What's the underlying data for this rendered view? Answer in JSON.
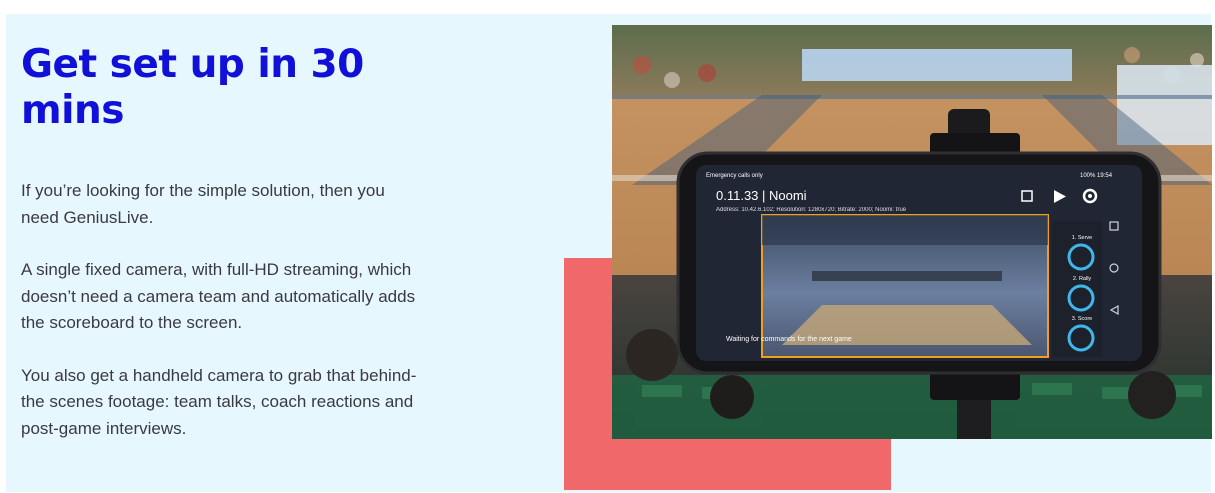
{
  "section": {
    "headline": "Get set up in 30 mins",
    "paragraphs": [
      "If you’re looking for the simple solution, then you need GeniusLive.",
      "A single fixed camera, with full-HD streaming, which doesn’t need a camera team and automatically adds the scoreboard to the screen.",
      "You also get a handheld camera to grab that behind-the scenes footage: team talks, coach reactions and post-game interviews."
    ]
  },
  "colors": {
    "headline": "#1010d8",
    "panel_background": "#e6f7fd",
    "accent_block": "#f0686a",
    "body_text": "#3a3a40"
  },
  "phone_screen": {
    "status_left": "Emergency calls only",
    "status_right": "100%   19:54",
    "title": "0.11.33 | Noomi",
    "subtitle": "Address: 10.42.6.102; Resolution: 1280x720; Bitrate: 2000; Noomi: true",
    "message": "Waiting for commands for the next game",
    "buttons": [
      "1. Serve",
      "2. Rally",
      "3. Score"
    ],
    "icons": [
      "crop-icon",
      "play-icon",
      "settings-icon",
      "square-nav-icon",
      "circle-nav-icon",
      "back-nav-icon"
    ]
  }
}
